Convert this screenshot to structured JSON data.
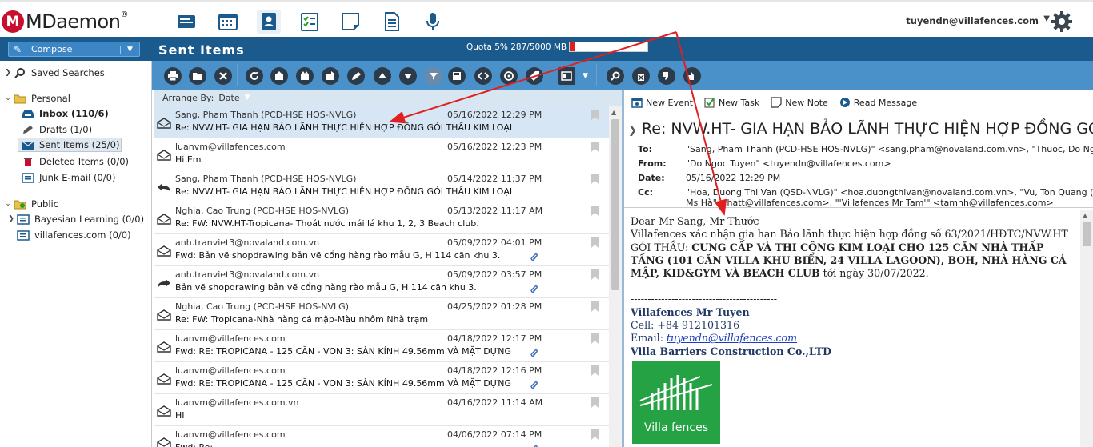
{
  "app": {
    "logo_text": "MDaemon",
    "user_email": "tuyendn@villafences.com",
    "nav_icons": [
      "mail-icon",
      "calendar-icon",
      "contacts-icon",
      "tasks-icon",
      "notes-icon",
      "documents-icon",
      "microphone-icon"
    ]
  },
  "header": {
    "compose_label": "Compose",
    "folder_title": "Sent Items",
    "quota_label": "Quota 5% 287/5000 MB",
    "quota_fraction": 0.057
  },
  "sidebar": {
    "saved_searches": "Saved Searches",
    "personal": "Personal",
    "inbox": "Inbox (110/6)",
    "drafts": "Drafts (1/0)",
    "sent": "Sent Items (25/0)",
    "deleted": "Deleted Items (0/0)",
    "junk": "Junk E-mail (0/0)",
    "public": "Public",
    "bayesian": "Bayesian Learning (0/0)",
    "villafences": "villafences.com (0/0)"
  },
  "list": {
    "arrange_label": "Arrange By:",
    "arrange_value": "Date",
    "messages": [
      {
        "from": "Sang, Pham Thanh (PCD-HSE HOS-NVLG)",
        "date": "05/16/2022 12:29 PM",
        "subject": "Re: NVW.HT- GIA HẠN BẢO LÃNH THỰC HIỆN HỢP ĐỒNG GÓI THẦU KIM LOẠI",
        "icon": "envelope-open-icon",
        "attach": false,
        "selected": true
      },
      {
        "from": "luanvm@villafences.com",
        "date": "05/16/2022 12:23 PM",
        "subject": "Hi Em",
        "icon": "envelope-open-icon",
        "attach": false,
        "selected": false
      },
      {
        "from": "Sang, Pham Thanh (PCD-HSE HOS-NVLG)",
        "date": "05/14/2022 11:37 PM",
        "subject": "Re: NVW.HT- GIA HẠN BẢO LÃNH THỰC HIỆN HỢP ĐỒNG GÓI THẦU KIM LOẠI",
        "icon": "reply-icon",
        "attach": false,
        "selected": false
      },
      {
        "from": "Nghia, Cao Trung (PCD-HSE HOS-NVLG)",
        "date": "05/13/2022 11:17 AM",
        "subject": "Re: FW: NVW.HT-Tropicana- Thoát nước mái lá khu 1, 2, 3 Beach club.",
        "icon": "envelope-open-icon",
        "attach": false,
        "selected": false
      },
      {
        "from": "anh.tranviet3@novaland.com.vn",
        "date": "05/09/2022 04:01 PM",
        "subject": "Fwd: Bản vẽ shopdrawing bản vẽ cổng hàng rào mẫu G, H 114 căn khu 3.",
        "icon": "envelope-open-icon",
        "attach": true,
        "selected": false
      },
      {
        "from": "anh.tranviet3@novaland.com.vn",
        "date": "05/09/2022 03:57 PM",
        "subject": "Bản vẽ shopdrawing bản vẽ cổng hàng rào mẫu G, H 114 căn khu 3.",
        "icon": "forward-icon",
        "attach": true,
        "selected": false
      },
      {
        "from": "Nghia, Cao Trung (PCD-HSE HOS-NVLG)",
        "date": "04/25/2022 01:28 PM",
        "subject": "Re: FW: Tropicana-Nhà hàng cá mập-Màu nhôm Nhà trạm",
        "icon": "envelope-open-icon",
        "attach": false,
        "selected": false
      },
      {
        "from": "luanvm@villafences.com",
        "date": "04/18/2022 12:17 PM",
        "subject": "Fwd: RE: TROPICANA - 125 CĂN - VON 3: SÀN KÍNH 49.56mm VÀ MẶT DỰNG",
        "icon": "envelope-open-icon",
        "attach": true,
        "selected": false
      },
      {
        "from": "luanvm@villafences.com",
        "date": "04/18/2022 12:16 PM",
        "subject": "Fwd: RE: TROPICANA - 125 CĂN - VON 3: SÀN KÍNH 49.56mm VÀ MẶT DỰNG",
        "icon": "envelope-open-icon",
        "attach": true,
        "selected": false
      },
      {
        "from": "luanvm@villafences.com.vn",
        "date": "04/16/2022 11:14 AM",
        "subject": "HI",
        "icon": "envelope-open-icon",
        "attach": false,
        "selected": false
      },
      {
        "from": "luanvm@villafences.com",
        "date": "04/06/2022 07:14 PM",
        "subject": "Fwd: Re: ...",
        "icon": "envelope-open-icon",
        "attach": true,
        "selected": false
      }
    ]
  },
  "reader": {
    "actions": [
      "New Event",
      "New Task",
      "New Note",
      "Read Message"
    ],
    "subject": "Re: NVW.HT- GIA HẠN BẢO LÃNH THỰC HIỆN HỢP ĐỒNG GÓI THẦU KIM LOẠI",
    "to_label": "To:",
    "to_value": "\"Sang, Pham Thanh (PCD-HSE HOS-NVLG)\" <sang.pham@novaland.com.vn>, \"Thuoc, Do Ngoc",
    "from_label": "From:",
    "from_value": "\"Do Ngoc Tuyen\" <tuyendn@villafences.com>",
    "date_label": "Date:",
    "date_value": "05/16/2022 12:29 PM",
    "cc_label": "Cc:",
    "cc_value": "\"Hoa, Duong Thi Van (QSD-NVLG)\" <hoa.duongthivan@novaland.com.vn>, \"Vu, Ton Quang (PM",
    "cc_value2": "Ms Hà\" <hatt@villafences.com>, \"'Villafences Mr Tam'\" <tamnh@villafences.com>",
    "body": {
      "greeting": "Dear Mr Sang, Mr Thước",
      "p1": "Villafences xác nhận gia hạn Bảo lãnh thực hiện hợp đồng số 63/2021/HĐTC/NVW.HT GÓI THẦU: ",
      "p1_bold": "CUNG CẤP VÀ THI CÔNG KIM LOẠI CHO 125 CĂN NHÀ THẤP TẦNG (101 CĂN VILLA KHU BIỂN, 24 VILLA LAGOON), BOH, NHÀ HÀNG CÁ MẬP, KID&GYM VÀ BEACH CLUB",
      "p1_end": " tới ngày 30/07/2022.",
      "divider": "-------------------------------------------",
      "sig_name": "Villafences Mr Tuyen",
      "cell": "Cell: +84 912101316",
      "email_label": "Email: ",
      "email": "tuyendn@villafences.com",
      "company": "Villa Barriers Construction Co.,LTD",
      "logo_text": "Villa fences"
    }
  },
  "colors": {
    "accent": "#1b5a8c",
    "toolbar": "#4a90c9",
    "annotation": "#e02020"
  }
}
